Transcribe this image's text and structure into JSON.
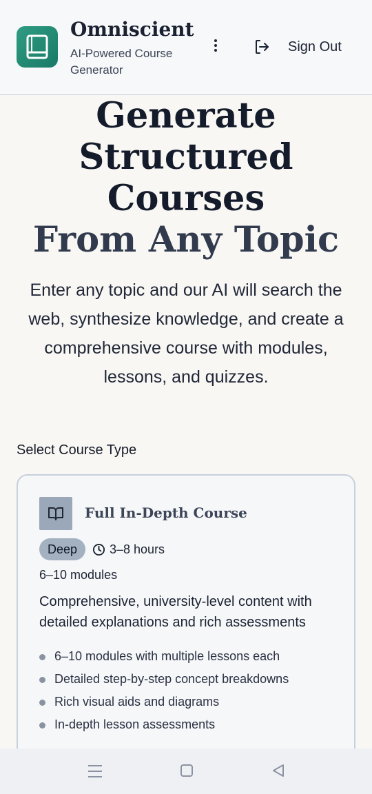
{
  "header": {
    "title": "Omniscient",
    "subtitle": "AI-Powered Course Generator",
    "logo_icon": "book-icon",
    "menu_icon": "more-vertical-icon",
    "signout_icon": "sign-out-icon",
    "signout_label": "Sign Out"
  },
  "hero": {
    "title_line1": "Generate Structured Courses",
    "title_line2": "From Any Topic",
    "subtitle": "Enter any topic and our AI will search the web, synthesize knowledge, and create a comprehensive course with modules, lessons, and quizzes."
  },
  "course_type": {
    "section_label": "Select Course Type",
    "card": {
      "icon": "open-book-icon",
      "title": "Full In-Depth Course",
      "badge": "Deep",
      "duration_icon": "clock-icon",
      "duration": "3–8 hours",
      "modules": "6–10 modules",
      "description": "Comprehensive, university-level content with detailed explanations and rich assessments",
      "features": [
        "6–10 modules with multiple lessons each",
        "Detailed step-by-step concept breakdowns",
        "Rich visual aids and diagrams",
        "In-depth lesson assessments"
      ]
    }
  },
  "navbar": {
    "recents_icon": "recents-icon",
    "home_icon": "home-icon",
    "back_icon": "back-icon"
  },
  "colors": {
    "accent": "#1f8a73",
    "page_bg": "#f9f7f4",
    "badge_bg": "#a4b1c1"
  }
}
